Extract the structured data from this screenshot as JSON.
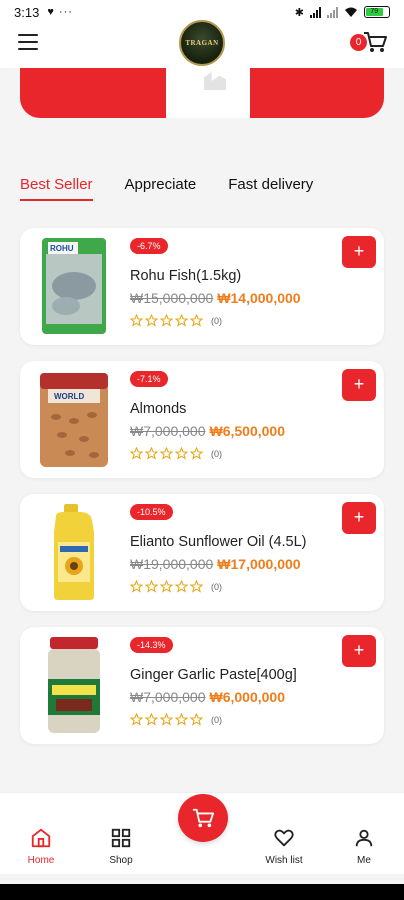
{
  "status": {
    "time": "3:13",
    "left_icons": "♥ ···",
    "bluetooth": "✱",
    "battery": "79"
  },
  "header": {
    "logo_text": "TRAGAN",
    "cart_count": "0"
  },
  "tabs": [
    {
      "label": "Best Seller"
    },
    {
      "label": "Appreciate"
    },
    {
      "label": "Fast delivery"
    }
  ],
  "products": [
    {
      "discount": "-6.7%",
      "name": "Rohu Fish(1.5kg)",
      "old_price": "₩15,000,000",
      "new_price": "₩14,000,000",
      "rating_count": "(0)",
      "rating": 0
    },
    {
      "discount": "-7.1%",
      "name": "Almonds",
      "old_price": "₩7,000,000",
      "new_price": "₩6,500,000",
      "rating_count": "(0)",
      "rating": 0
    },
    {
      "discount": "-10.5%",
      "name": "Elianto Sunflower Oil (4.5L)",
      "old_price": "₩19,000,000",
      "new_price": "₩17,000,000",
      "rating_count": "(0)",
      "rating": 0
    },
    {
      "discount": "-14.3%",
      "name": "Ginger Garlic Paste[400g]",
      "old_price": "₩7,000,000",
      "new_price": "₩6,000,000",
      "rating_count": "(0)",
      "rating": 0
    }
  ],
  "add_button_label": "+",
  "nav": {
    "home": "Home",
    "shop": "Shop",
    "wishlist": "Wish list",
    "me": "Me"
  },
  "colors": {
    "accent": "#e8262b",
    "price": "#f07d1c"
  }
}
